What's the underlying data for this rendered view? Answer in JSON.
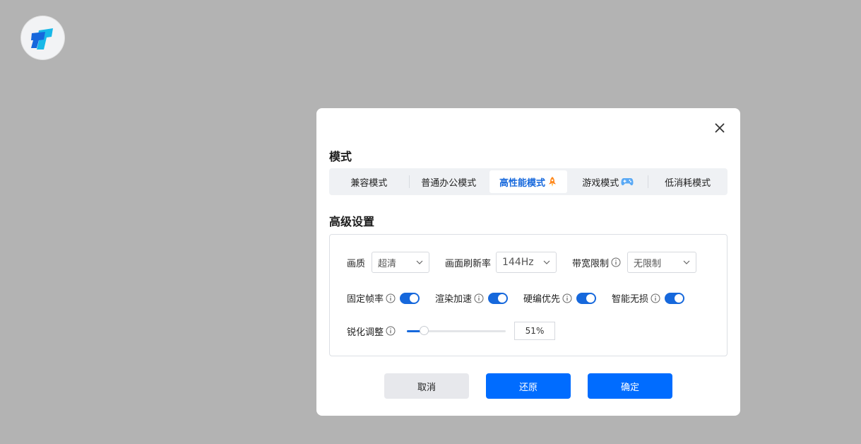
{
  "dialog": {
    "mode_title": "模式",
    "mode_tabs": [
      {
        "label": "兼容模式",
        "icon": ""
      },
      {
        "label": "普通办公模式",
        "icon": ""
      },
      {
        "label": "高性能模式",
        "icon": "rocket-icon",
        "active": true
      },
      {
        "label": "游戏模式",
        "icon": "gamepad-icon"
      },
      {
        "label": "低消耗模式",
        "icon": ""
      }
    ],
    "advanced_title": "高级设置",
    "quality": {
      "label": "画质",
      "value": "超清"
    },
    "refresh_rate": {
      "label": "画面刷新率",
      "value": "144Hz"
    },
    "bandwidth": {
      "label": "带宽限制",
      "value": "无限制"
    },
    "toggles": [
      {
        "label": "固定帧率",
        "on": true
      },
      {
        "label": "渲染加速",
        "on": true
      },
      {
        "label": "硬编优先",
        "on": true
      },
      {
        "label": "智能无损",
        "on": true
      }
    ],
    "sharpen": {
      "label": "锐化调整",
      "value_text": "51%",
      "fraction": 0.17
    },
    "buttons": {
      "cancel": "取消",
      "reset": "还原",
      "ok": "确定"
    }
  },
  "colors": {
    "accent": "#1668dc",
    "primary_button": "#006cff",
    "backdrop": "#b3b3b3"
  }
}
